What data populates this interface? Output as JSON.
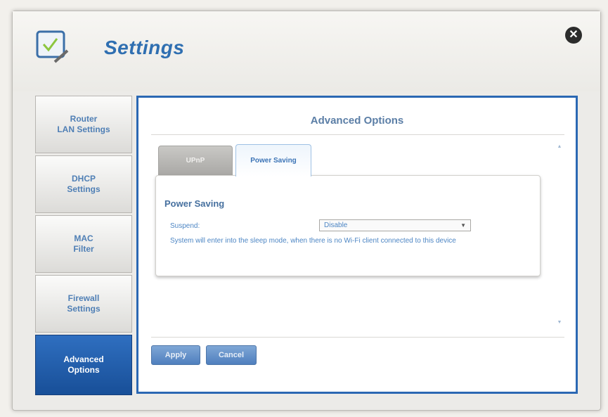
{
  "window": {
    "title": "Settings",
    "close_glyph": "✕",
    "app_icon": "checkbox-icon"
  },
  "sidebar": {
    "items": [
      {
        "label": "Router\nLAN Settings",
        "active": false
      },
      {
        "label": "DHCP\nSettings",
        "active": false
      },
      {
        "label": "MAC\nFilter",
        "active": false
      },
      {
        "label": "Firewall\nSettings",
        "active": false
      },
      {
        "label": "Advanced\nOptions",
        "active": true
      }
    ]
  },
  "content": {
    "title": "Advanced Options",
    "tabs": [
      {
        "label": "UPnP",
        "active": false
      },
      {
        "label": "Power Saving",
        "active": true
      }
    ],
    "section": {
      "heading": "Power Saving",
      "suspend_label": "Suspend:",
      "suspend_value": "Disable",
      "help_text": "System will enter into the sleep mode, when there is no Wi-Fi client connected to this device"
    },
    "buttons": {
      "apply": "Apply",
      "cancel": "Cancel"
    }
  },
  "colors": {
    "accent": "#2f6fb1",
    "active_tab_bg": "#1f5ba8",
    "content_border": "#2b68b3"
  }
}
